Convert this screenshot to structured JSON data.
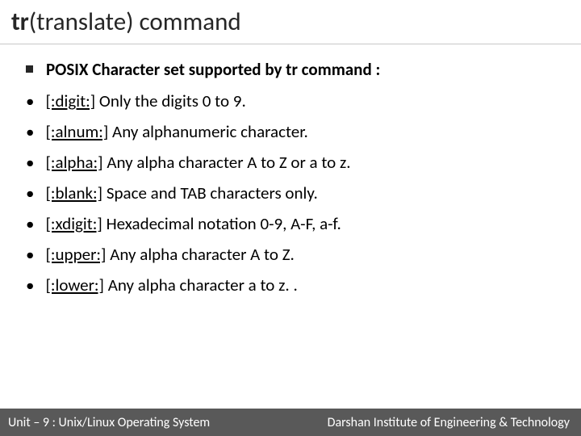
{
  "title": {
    "strong": "tr",
    "rest": "(translate) command"
  },
  "heading": "POSIX Character set supported by tr command :",
  "items": [
    {
      "term": "[:digit:]",
      "desc": " Only the digits 0 to 9."
    },
    {
      "term": "[:alnum:]",
      "desc": " Any alphanumeric character."
    },
    {
      "term": "[:alpha:]",
      "desc": " Any alpha character A to Z or a to z."
    },
    {
      "term": "[:blank:]",
      "desc": " Space and TAB characters only."
    },
    {
      "term": "[:xdigit:]",
      "desc": " Hexadecimal notation 0-9, A-F, a-f."
    },
    {
      "term": "[:upper:]",
      "desc": " Any alpha character A to Z."
    },
    {
      "term": "[:lower:]",
      "desc": " Any alpha character a to z. ."
    }
  ],
  "footer": {
    "left": "Unit – 9  : Unix/Linux Operating System",
    "right": "Darshan Institute of Engineering & Technology"
  }
}
